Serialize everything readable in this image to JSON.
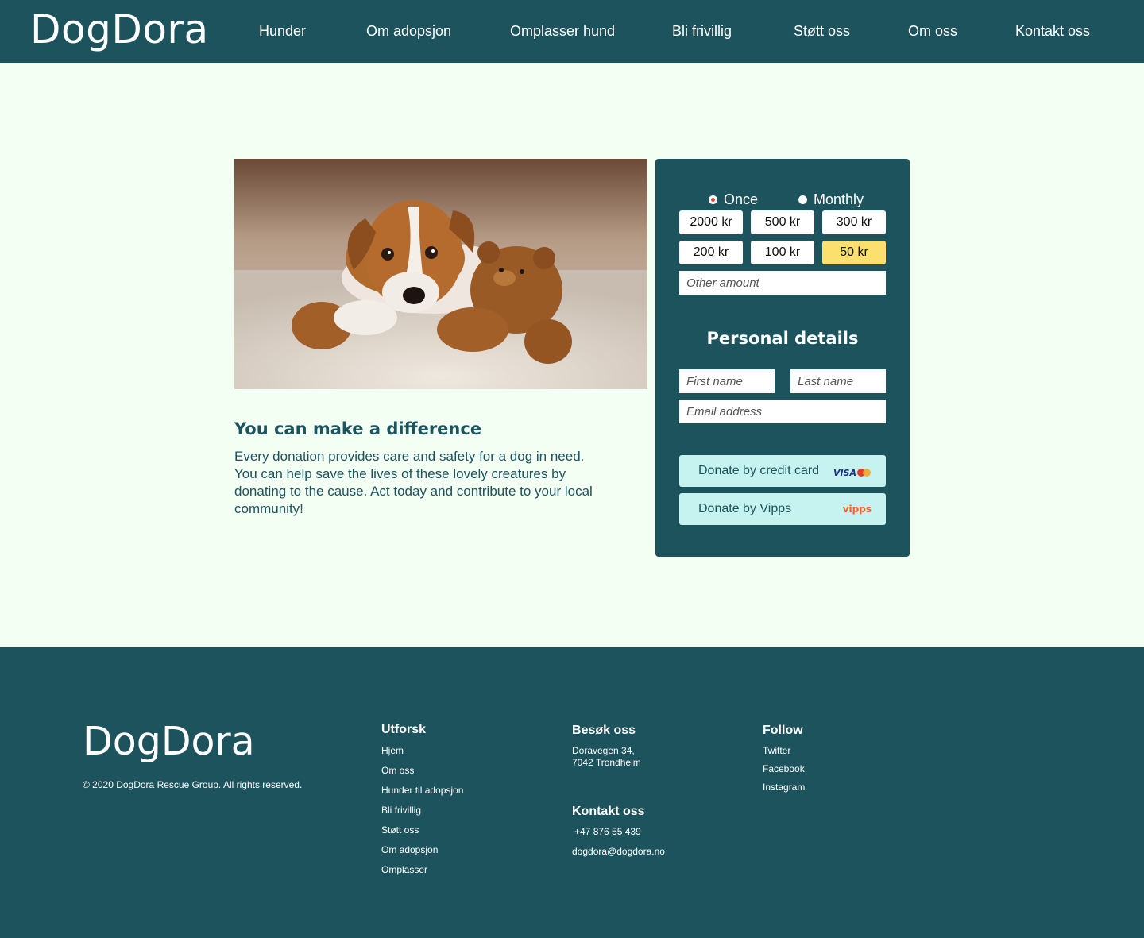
{
  "header": {
    "logo": "DogDora",
    "nav": [
      "Hunder",
      "Om adopsjon",
      "Omplasser hund",
      "Bli frivillig",
      "Støtt oss",
      "Om oss",
      "Kontakt oss"
    ]
  },
  "hero": {
    "title": "You can make a difference",
    "text": "Every donation provides care and safety for a dog in need. You can help save the lives of these lovely creatures by donating to the cause. Act today and contribute to your local community!"
  },
  "donation": {
    "frequency": [
      {
        "label": "Once",
        "selected": true
      },
      {
        "label": "Monthly",
        "selected": false
      }
    ],
    "amounts": [
      {
        "label": "2000 kr",
        "selected": false
      },
      {
        "label": "500 kr",
        "selected": false
      },
      {
        "label": "300 kr",
        "selected": false
      },
      {
        "label": "200 kr",
        "selected": false
      },
      {
        "label": "100 kr",
        "selected": false
      },
      {
        "label": "50 kr",
        "selected": true
      }
    ],
    "other_amount_placeholder": "Other amount",
    "personal_details_title": "Personal details",
    "first_name_placeholder": "First name",
    "last_name_placeholder": "Last name",
    "email_placeholder": "Email address",
    "card_button": "Donate by credit card",
    "card_brand": "VISA",
    "vipps_button": "Donate by Vipps",
    "vipps_brand": "vipps"
  },
  "footer": {
    "logo": "DogDora",
    "copyright": "© 2020 DogDora Rescue Group. All rights reserved.",
    "explore": {
      "title": "Utforsk",
      "links": [
        "Hjem",
        "Om oss",
        "Hunder til adopsjon",
        "Bli frivillig",
        "Støtt oss",
        "Om adopsjon",
        "Omplasser"
      ]
    },
    "visit": {
      "title": "Besøk oss",
      "address_line1": "Doravegen 34,",
      "address_line2": "7042 Trondheim"
    },
    "contact": {
      "title": "Kontakt oss",
      "phone": "+47 876 55 439",
      "email": "dogdora@dogdora.no"
    },
    "follow": {
      "title": "Follow",
      "links": [
        "Twitter",
        "Facebook",
        "Instagram"
      ]
    }
  },
  "colors": {
    "primary": "#1c535c",
    "background": "#f4fff4",
    "selected_amount": "#fbe06f",
    "donate_button": "#c6f3ef",
    "radio_selected": "#e0473a"
  },
  "icons": {
    "photo": "puppy-with-teddy-bear-photo",
    "card": "visa-mastercard-icon",
    "vipps": "vipps-logo-icon"
  }
}
